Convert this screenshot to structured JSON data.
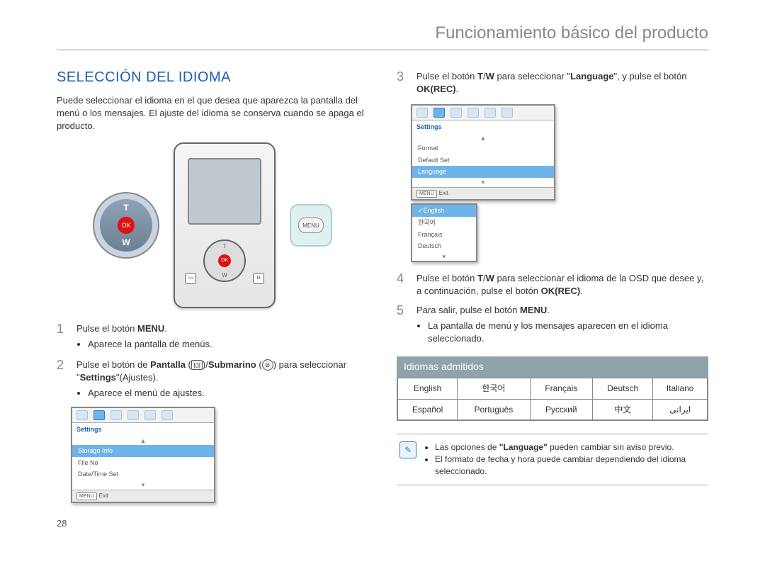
{
  "header": {
    "title": "Funcionamiento básico del producto"
  },
  "page_number": "28",
  "section": {
    "heading": "SELECCIÓN DEL IDIOMA"
  },
  "intro": "Puede seleccionar el idioma en el que desea que aparezca la pantalla del menú o los mensajes. El ajuste del idioma se conserva cuando se apaga el producto.",
  "device": {
    "ok": "OK",
    "t": "T",
    "w": "W",
    "menu": "MENU",
    "u_btn": "U"
  },
  "steps": {
    "s1_num": "1",
    "s1_a": "Pulse el botón ",
    "s1_b": "MENU",
    "s1_c": ".",
    "s1_bul": "Aparece la pantalla de menús.",
    "s2_num": "2",
    "s2_a": "Pulse el botón de ",
    "s2_b": "Pantalla",
    "s2_c": " (",
    "s2_d": ")/",
    "s2_e": "Submarino",
    "s2_f": " (",
    "s2_g": ") para seleccionar \"",
    "s2_h": "Settings",
    "s2_i": "\"(Ajustes).",
    "s2_bul": "Aparece el menú de ajustes.",
    "s3_num": "3",
    "s3_a": "Pulse el botón ",
    "s3_b": "T",
    "s3_c": "/",
    "s3_d": "W",
    "s3_e": " para seleccionar \"",
    "s3_f": "Language",
    "s3_g": "\", y pulse el botón ",
    "s3_h": "OK(REC)",
    "s3_i": ".",
    "s4_num": "4",
    "s4_a": "Pulse el botón ",
    "s4_b": "T",
    "s4_c": "/",
    "s4_d": "W",
    "s4_e": " para seleccionar el idioma de la OSD que desee y, a continuación, pulse el botón ",
    "s4_f": "OK(REC)",
    "s4_g": ".",
    "s5_num": "5",
    "s5_a": "Para salir, pulse el botón ",
    "s5_b": "MENU",
    "s5_c": ".",
    "s5_bul": "La pantalla de menú y los mensajes aparecen en el idioma seleccionado."
  },
  "shot1": {
    "title": "Settings",
    "rows": [
      "Storage Info",
      "File No",
      "Date/Time Set"
    ],
    "menu_tag": "MENU",
    "exit": "Exit"
  },
  "shot2": {
    "title": "Settings",
    "rows": [
      "Format",
      "Default Set",
      "Language"
    ],
    "submenu": [
      "English",
      "한국어",
      "Français",
      "Deutsch"
    ],
    "menu_tag": "MENU",
    "exit": "Exit"
  },
  "lang_section": {
    "header": "Idiomas admitidos",
    "cells": [
      [
        "English",
        "한국어",
        "Français",
        "Deutsch",
        "Italiano"
      ],
      [
        "Español",
        "Português",
        "Русский",
        "中文",
        "ایرانی"
      ]
    ]
  },
  "notes": {
    "n1_a": "Las opciones de ",
    "n1_b": "\"Language\"",
    "n1_c": " pueden cambiar sin aviso previo.",
    "n2": "El formato de fecha y hora puede cambiar dependiendo del idioma seleccionado."
  }
}
